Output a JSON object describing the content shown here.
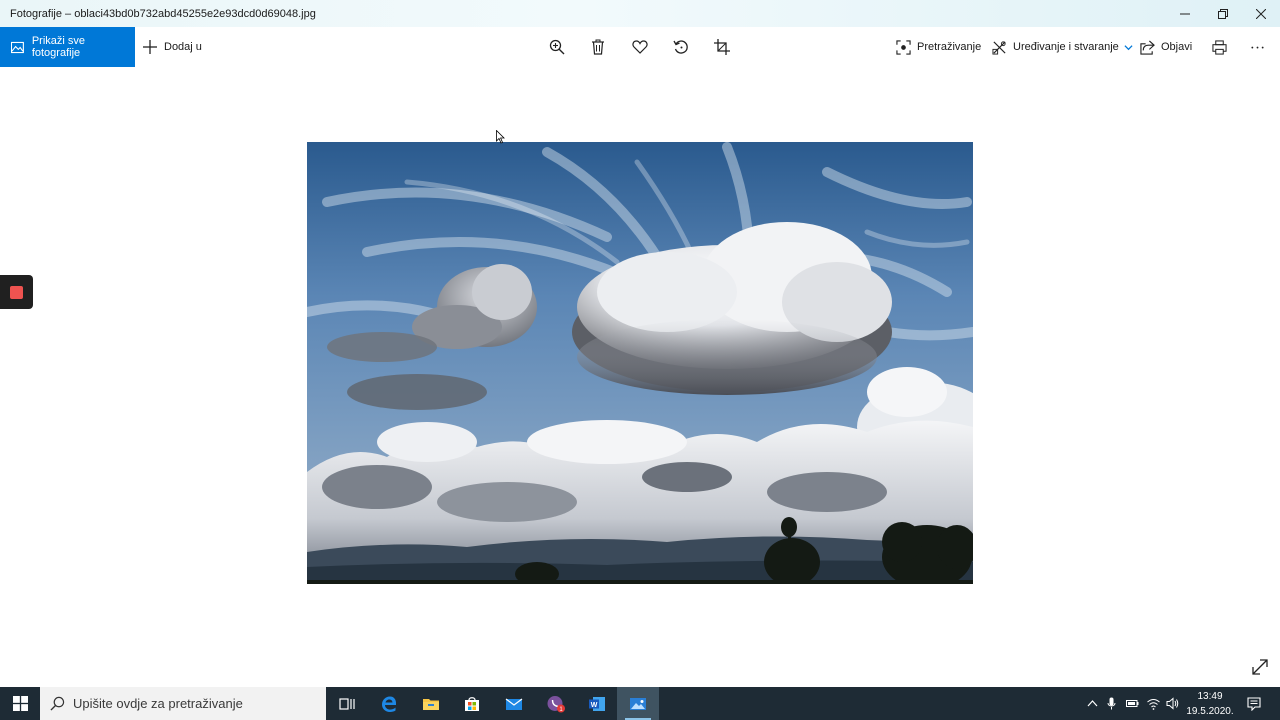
{
  "window": {
    "title": "Fotografije – oblaci43bd0b732abd45255e2e93dcd0d69048.jpg",
    "controls": [
      "minimize-icon",
      "maximize-icon",
      "close-icon"
    ]
  },
  "toolbar": {
    "show_all_label": "Prikaži sve fotografije",
    "add_to_label": "Dodaj u",
    "center_tools": [
      "zoom-icon",
      "delete-icon",
      "heart-icon",
      "rotate-icon",
      "crop-icon"
    ],
    "search_label": "Pretraživanje",
    "edit_label": "Uređivanje i stvaranje",
    "share_label": "Objavi",
    "print_icon": "print-icon",
    "more_icon": "more-icon"
  },
  "photo": {
    "subject": "clouds-photo"
  },
  "taskbar": {
    "search_placeholder": "Upišite ovdje za pretraživanje",
    "apps": [
      "task-view-icon",
      "edge-icon",
      "file-explorer-icon",
      "store-icon",
      "mail-icon",
      "viber-icon",
      "word-icon",
      "photos-icon"
    ],
    "viber_badge": "1",
    "time": "13:49",
    "date": "19.5.2020."
  },
  "colors": {
    "accent": "#0078d7",
    "taskbar": "#1e2b35",
    "record": "#ef5350"
  }
}
